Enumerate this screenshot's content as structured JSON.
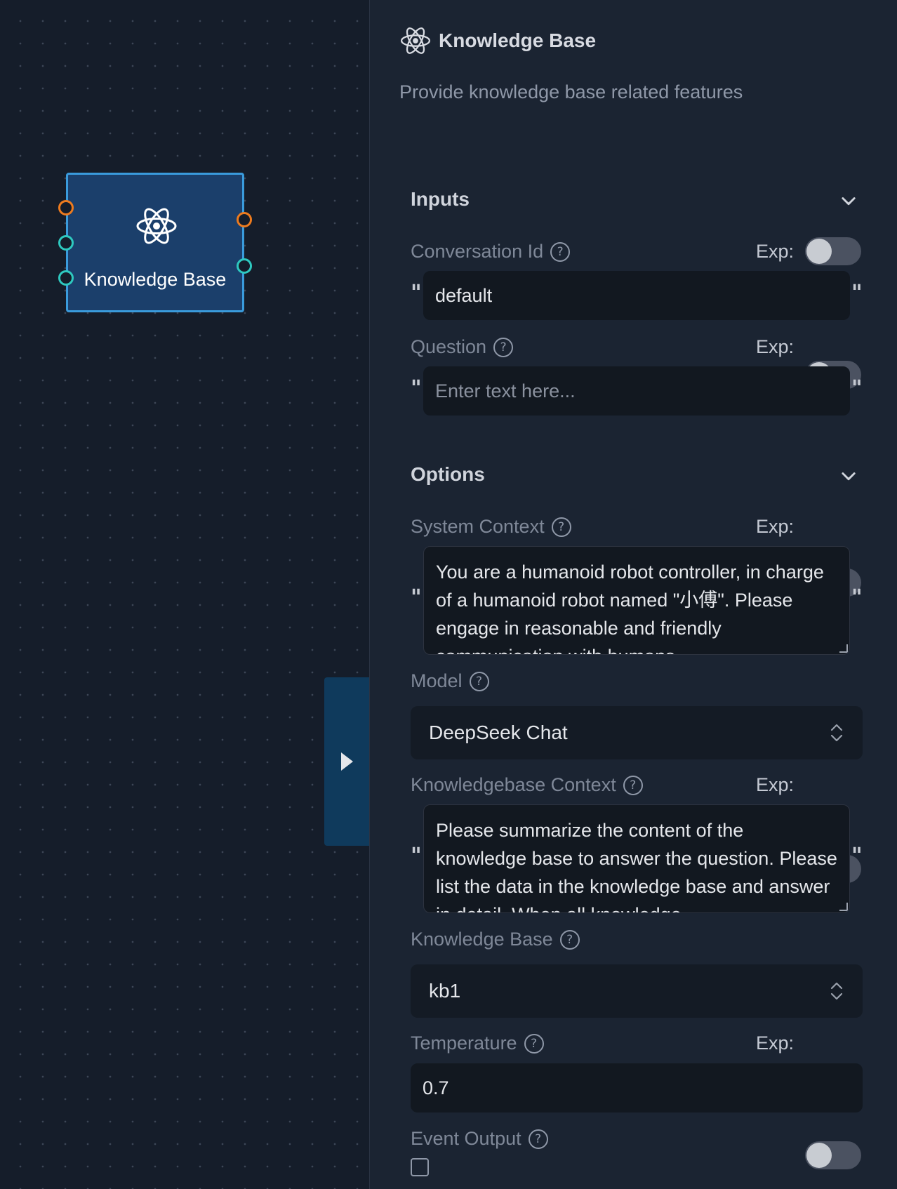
{
  "node": {
    "title": "Knowledge Base",
    "icon": "atom-icon"
  },
  "panel": {
    "title": "Knowledge Base",
    "icon": "atom-icon",
    "description": "Provide knowledge base related features"
  },
  "inputs": {
    "section_title": "Inputs",
    "conversation_id": {
      "label": "Conversation Id",
      "exp_label": "Exp:",
      "value": "default"
    },
    "question": {
      "label": "Question",
      "exp_label": "Exp:",
      "placeholder": "Enter text here..."
    }
  },
  "options": {
    "section_title": "Options",
    "system_context": {
      "label": "System Context",
      "exp_label": "Exp:",
      "value": "You are a humanoid robot controller, in charge of a humanoid robot named \"小傅\". Please engage in reasonable and friendly communication with humans."
    },
    "model": {
      "label": "Model",
      "value": "DeepSeek Chat"
    },
    "knowledgebase_context": {
      "label": "Knowledgebase Context",
      "exp_label": "Exp:",
      "value": "Please summarize the content of the knowledge base to answer the question. Please list the data in the knowledge base and answer in detail. When all knowledge"
    },
    "knowledge_base": {
      "label": "Knowledge Base",
      "value": "kb1"
    },
    "temperature": {
      "label": "Temperature",
      "exp_label": "Exp:",
      "value": "0.7"
    },
    "event_output": {
      "label": "Event Output",
      "checked": false
    }
  },
  "quote_char": "\"",
  "help_char": "?",
  "colors": {
    "canvas_bg": "#151d2a",
    "node_bg": "#1b3f6b",
    "node_border": "#3a9bdc",
    "handle_orange": "#ee7b1e",
    "handle_teal": "#2ec9c0",
    "panel_bg": "#1b2432",
    "collapse_tab": "#0f3a5c"
  }
}
